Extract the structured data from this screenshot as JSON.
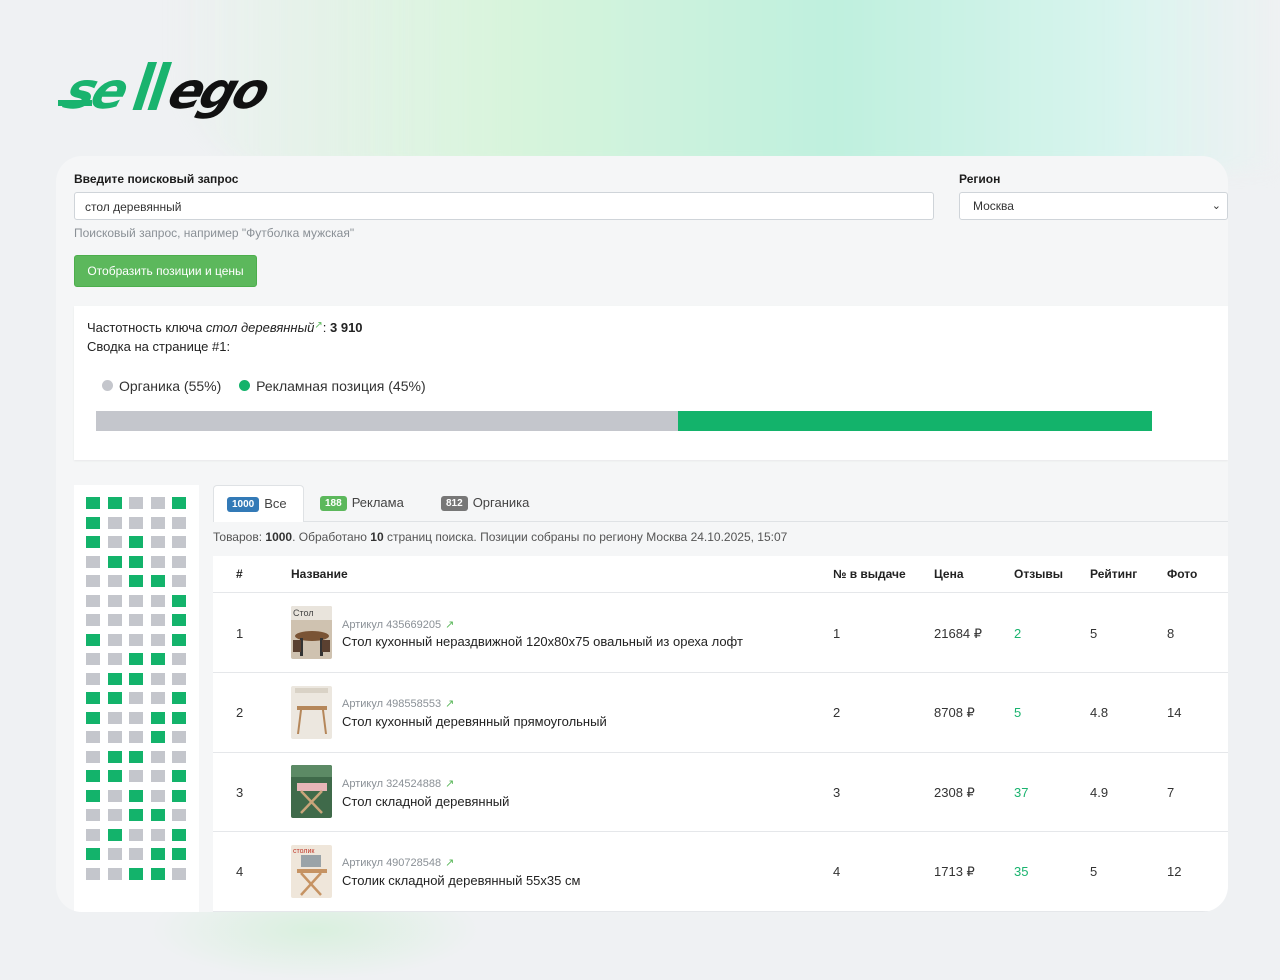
{
  "brand": {
    "logo_text": "sellego",
    "color": "#19b36e"
  },
  "search": {
    "label": "Введите поисковый запрос",
    "value": "стол деревянный",
    "hint": "Поисковый запрос, например \"Футболка мужская\""
  },
  "region": {
    "label": "Регион",
    "value": "Москва"
  },
  "show_button": "Отобразить позиции и цены",
  "summary": {
    "freq_prefix": "Частотность ключа",
    "freq_key": "стол деревянный",
    "freq_value": "3 910",
    "page_summary": "Сводка на странице #1:",
    "organic_label": "Органика (55%)",
    "ads_label": "Рекламная позиция (45%)",
    "organic_share": 55,
    "ads_share": 45,
    "organic_color": "#c4c6cc",
    "ads_color": "#13b36b"
  },
  "position_grid": {
    "columns": 5,
    "cells": [
      1,
      1,
      0,
      0,
      1,
      1,
      0,
      0,
      0,
      0,
      1,
      0,
      1,
      0,
      0,
      0,
      1,
      1,
      0,
      0,
      0,
      0,
      1,
      1,
      0,
      0,
      0,
      0,
      0,
      1,
      0,
      0,
      0,
      0,
      1,
      1,
      0,
      0,
      0,
      1,
      0,
      0,
      1,
      1,
      0,
      0,
      1,
      1,
      0,
      0,
      1,
      1,
      0,
      0,
      1,
      1,
      0,
      0,
      1,
      1,
      0,
      0,
      0,
      1,
      0,
      0,
      1,
      1,
      0,
      0,
      1,
      1,
      0,
      0,
      1,
      1,
      0,
      1,
      0,
      1,
      0,
      0,
      1,
      1,
      0,
      0,
      1,
      0,
      0,
      1,
      1,
      0,
      0,
      1,
      1,
      0,
      0,
      1,
      1,
      0
    ]
  },
  "tabs": [
    {
      "count": "1000",
      "label": "Все",
      "badge_color": "#337ab7",
      "active": true
    },
    {
      "count": "188",
      "label": "Реклама",
      "badge_color": "#5cb85c",
      "active": false
    },
    {
      "count": "812",
      "label": "Органика",
      "badge_color": "#777777",
      "active": false
    }
  ],
  "info": {
    "prefix": "Товаров:",
    "total": "1000",
    "mid1": ". Обработано",
    "pages": "10",
    "suffix": "страниц поиска. Позиции собраны по региону Москва 24.10.2025, 15:07"
  },
  "table": {
    "headers": {
      "num": "#",
      "name": "Название",
      "pos": "№ в выдаче",
      "price": "Цена",
      "reviews": "Отзывы",
      "rating": "Рейтинг",
      "photo": "Фото"
    },
    "rows": [
      {
        "num": "1",
        "article": "Артикул 435669205",
        "name": "Стол кухонный нераздвижной 120х80х75 овальный из ореха лофт",
        "pos": "1",
        "price": "21684 ₽",
        "reviews": "2",
        "rating": "5",
        "photo": "8",
        "thumb_text": "Стол"
      },
      {
        "num": "2",
        "article": "Артикул 498558553",
        "name": "Стол кухонный деревянный прямоугольный",
        "pos": "2",
        "price": "8708 ₽",
        "reviews": "5",
        "rating": "4.8",
        "photo": "14",
        "thumb_text": ""
      },
      {
        "num": "3",
        "article": "Артикул 324524888",
        "name": "Стол складной деревянный",
        "pos": "3",
        "price": "2308 ₽",
        "reviews": "37",
        "rating": "4.9",
        "photo": "7",
        "thumb_text": ""
      },
      {
        "num": "4",
        "article": "Артикул 490728548",
        "name": "Столик складной деревянный 55х35 см",
        "pos": "4",
        "price": "1713 ₽",
        "reviews": "35",
        "rating": "5",
        "photo": "12",
        "thumb_text": "столик"
      }
    ]
  }
}
